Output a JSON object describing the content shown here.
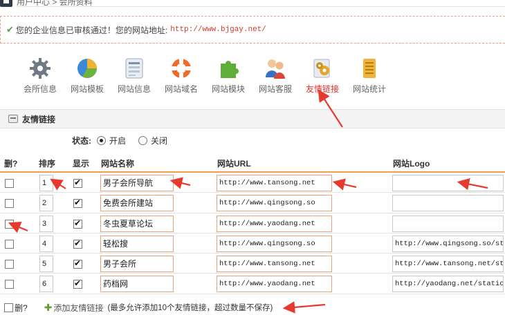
{
  "breadcrumb": {
    "path": "用户中心 > 会所资料"
  },
  "notice": {
    "message": "您的企业信息已审核通过！您的网站地址:",
    "url": "http://www.bjgay.net/"
  },
  "modules": [
    {
      "label": "会所信息",
      "icon": "gear-icon"
    },
    {
      "label": "网站模板",
      "icon": "pie-chart-icon"
    },
    {
      "label": "网站信息",
      "icon": "form-icon"
    },
    {
      "label": "网站域名",
      "icon": "lifebuoy-icon"
    },
    {
      "label": "网站模块",
      "icon": "puzzle-icon"
    },
    {
      "label": "网站客服",
      "icon": "users-icon"
    },
    {
      "label": "友情链接",
      "icon": "gears-icon",
      "active": true
    },
    {
      "label": "网站统计",
      "icon": "bar-chart-icon"
    }
  ],
  "section": {
    "title": "友情链接"
  },
  "status": {
    "label": "状态:",
    "on_label": "开启",
    "off_label": "关闭",
    "selected": "开启"
  },
  "table": {
    "headers": {
      "delete": "删?",
      "order": "排序",
      "show": "显示",
      "name": "网站名称",
      "url": "网站URL",
      "logo": "网站Logo"
    },
    "rows": [
      {
        "order": "1",
        "show": true,
        "name": "男子会所导航",
        "url": "http://www.tansong.net",
        "logo": ""
      },
      {
        "order": "2",
        "show": true,
        "name": "免费会所建站",
        "url": "http://www.qingsong.so",
        "logo": ""
      },
      {
        "order": "3",
        "show": true,
        "name": "冬虫夏草论坛",
        "url": "http://www.yaodang.net",
        "logo": ""
      },
      {
        "order": "4",
        "show": true,
        "name": "轻松搜",
        "url": "http://www.qingsong.so",
        "logo": "http://www.qingsong.so/sta"
      },
      {
        "order": "5",
        "show": true,
        "name": "男子会所",
        "url": "http://www.tansong.net",
        "logo": "http://www.tansong.net/sta"
      },
      {
        "order": "6",
        "show": true,
        "name": "药档网",
        "url": "http://www.yaodang.net",
        "logo": "http://yaodang.net/static/"
      }
    ]
  },
  "footer": {
    "delete_label": "删?",
    "add_label": "添加友情链接",
    "hint": "(最多允许添加10个友情链接，超过数量不保存)"
  },
  "colors": {
    "accent_red": "#e0312d",
    "header_underline": "#f0a04c",
    "input_border": "#e6a27a",
    "notice_border": "#f29b8e",
    "check_green": "#4aa54a"
  }
}
